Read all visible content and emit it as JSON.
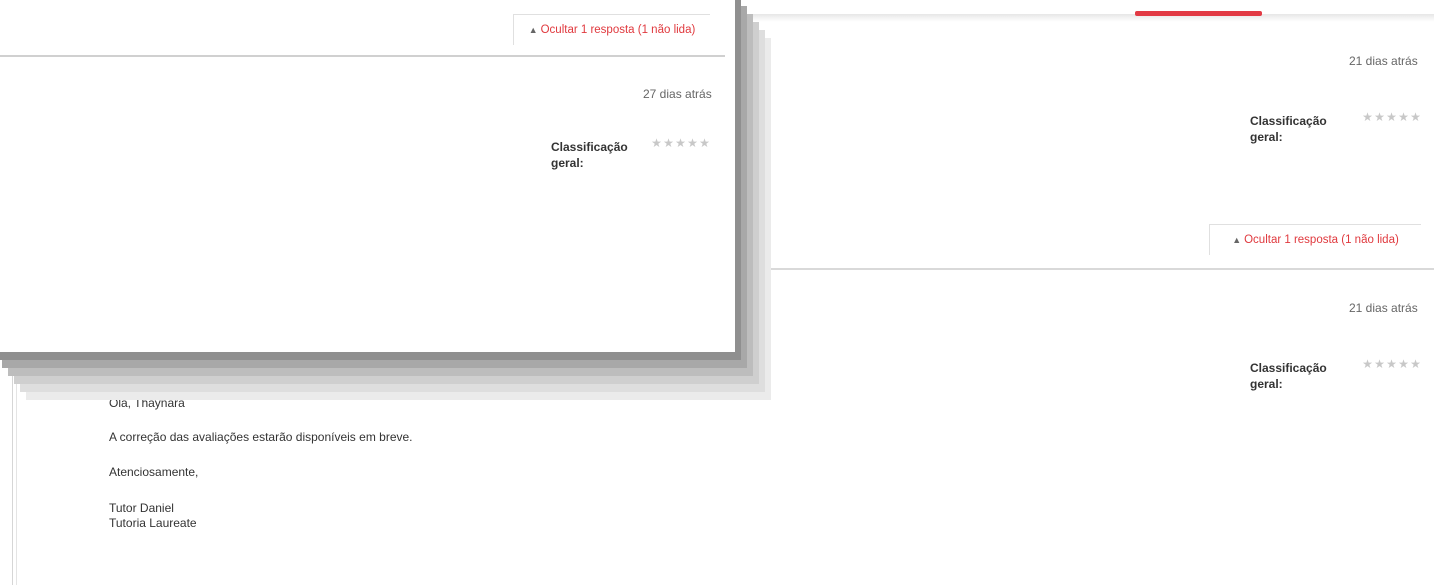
{
  "background_post": {
    "timestamp_1": "21 dias atrás",
    "rating_1": {
      "label": "Classificação geral:",
      "stars": 5,
      "filled": 0
    },
    "reply_toggle": {
      "arrow": "▲",
      "label": "Ocultar 1 resposta (1 não lida)"
    },
    "timestamp_2": "21 dias atrás",
    "rating_2": {
      "label": "Classificação geral:",
      "stars": 5,
      "filled": 0
    },
    "message": {
      "greeting": "Olá, Thaynara",
      "body": "A correção das avaliações estarão disponíveis em breve.",
      "closing": "Atenciosamente,",
      "signature_name": "Tutor Daniel",
      "signature_org": "Tutoria Laureate"
    }
  },
  "floating_panel": {
    "reply_toggle": {
      "arrow": "▲",
      "label": "Ocultar 1 resposta (1 não lida)"
    },
    "timestamp": "27 dias atrás",
    "rating": {
      "label": "Classificação geral:",
      "stars": 5,
      "filled": 0
    }
  },
  "colors": {
    "accent": "#e23a44",
    "link": "#e0393e",
    "star_empty": "#c8c8c8"
  }
}
